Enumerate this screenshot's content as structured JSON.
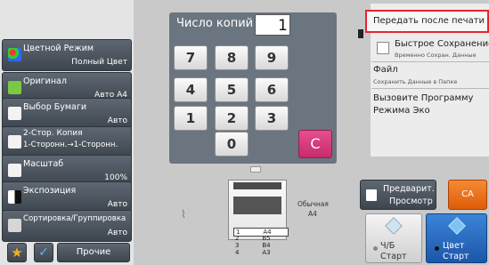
{
  "left_panel": {
    "color_mode": {
      "label": "Цветной Режим",
      "value": "Полный Цвет"
    },
    "original": {
      "label": "Оригинал",
      "value": "Авто A4"
    },
    "paper": {
      "label": "Выбор Бумаги",
      "value": "Авто"
    },
    "duplex": {
      "label": "2-Стор. Копия",
      "value": "1-Сторонн.→1-Сторонн."
    },
    "scale": {
      "label": "Масштаб",
      "value": "100%"
    },
    "exposure": {
      "label": "Экспозиция",
      "value": "Авто"
    },
    "sort": {
      "label": "Сортировка/Группировка",
      "value": "Авто"
    },
    "other_label": "Прочие"
  },
  "copies": {
    "label": "Число копий",
    "value": "1"
  },
  "keypad": {
    "keys": [
      "7",
      "8",
      "9",
      "4",
      "5",
      "6",
      "1",
      "2",
      "3",
      "0"
    ],
    "clear_label": "C"
  },
  "tray": {
    "media_type": "Обычная",
    "media_size": "A4",
    "rows": [
      {
        "num": "1",
        "size": "A4"
      },
      {
        "num": "2",
        "size": "B5"
      },
      {
        "num": "3",
        "size": "B4"
      },
      {
        "num": "4",
        "size": "A3"
      }
    ]
  },
  "right_panel": {
    "send_after_print": "Передать после печати",
    "quick_save": {
      "label": "Быстрое Сохранение",
      "sub": "Временно Сохран. Данные"
    },
    "file": {
      "label": "Файл",
      "sub": "Сохранить Данные в Папке"
    },
    "eco": {
      "line1": "Вызовите Программу",
      "line2": "Режима Эко"
    },
    "preview": {
      "line1": "Предварит.",
      "line2": "Просмотр"
    },
    "ca_label": "CA",
    "bw_start": {
      "line1": "Ч/Б",
      "line2": "Старт"
    },
    "color_start": {
      "line1": "Цвет",
      "line2": "Старт"
    }
  },
  "colors": {
    "clear_key": "#d9337a",
    "ca_button": "#ef6b0e",
    "highlight": "#e8242e",
    "start_blue": "#1f63b8"
  }
}
